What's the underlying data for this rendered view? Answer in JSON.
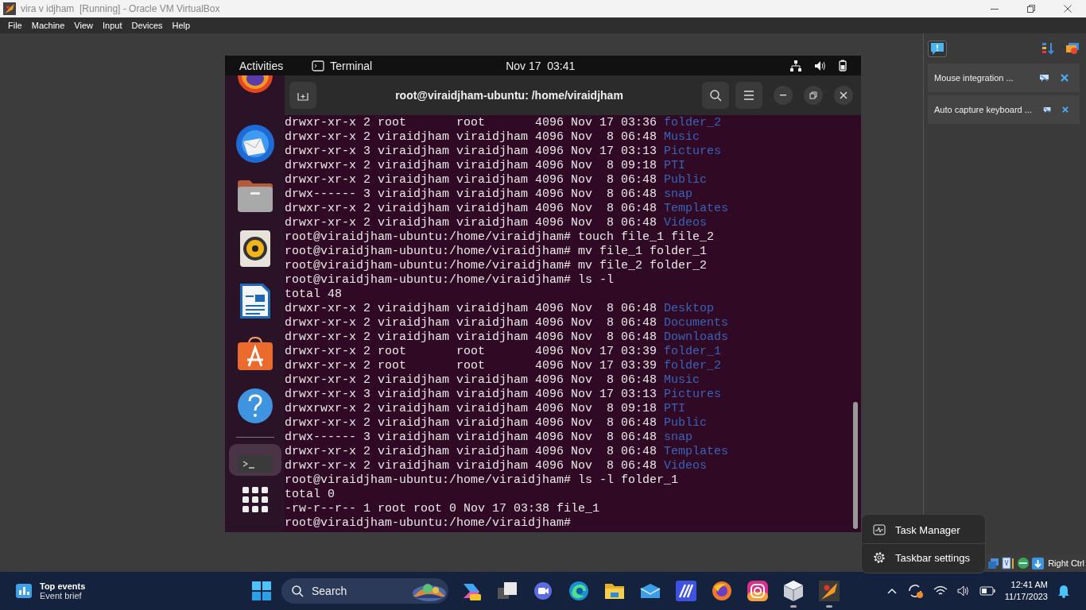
{
  "window": {
    "title": "vira v idjham  [Running] - Oracle VM VirtualBox"
  },
  "menu": [
    "File",
    "Machine",
    "View",
    "Input",
    "Devices",
    "Help"
  ],
  "guest": {
    "top_bar": {
      "activities": "Activities",
      "app": "Terminal",
      "clock": "Nov 17  03:41"
    },
    "dock": [
      {
        "kind": "firefox",
        "selected": false
      },
      {
        "kind": "thunderbird",
        "selected": false
      },
      {
        "kind": "files",
        "selected": false
      },
      {
        "kind": "rhythmbox",
        "selected": false
      },
      {
        "kind": "writer",
        "selected": false
      },
      {
        "kind": "appcenter",
        "selected": false
      },
      {
        "kind": "help",
        "selected": false
      },
      {
        "kind": "terminal",
        "selected": true
      },
      {
        "kind": "apps",
        "selected": false
      }
    ],
    "terminal": {
      "title": "root@viraidjham-ubuntu: /home/viraidjham",
      "lines": [
        {
          "text": "drwxr-xr-x 2 root       root       4096 Nov 17 03:36 ",
          "dir": "folder_2"
        },
        {
          "text": "drwxr-xr-x 2 viraidjham viraidjham 4096 Nov  8 06:48 ",
          "dir": "Music"
        },
        {
          "text": "drwxr-xr-x 3 viraidjham viraidjham 4096 Nov 17 03:13 ",
          "dir": "Pictures"
        },
        {
          "text": "drwxrwxr-x 2 viraidjham viraidjham 4096 Nov  8 09:18 ",
          "dir": "PTI"
        },
        {
          "text": "drwxr-xr-x 2 viraidjham viraidjham 4096 Nov  8 06:48 ",
          "dir": "Public"
        },
        {
          "text": "drwx------ 3 viraidjham viraidjham 4096 Nov  8 06:48 ",
          "dir": "snap"
        },
        {
          "text": "drwxr-xr-x 2 viraidjham viraidjham 4096 Nov  8 06:48 ",
          "dir": "Templates"
        },
        {
          "text": "drwxr-xr-x 2 viraidjham viraidjham 4096 Nov  8 06:48 ",
          "dir": "Videos"
        },
        {
          "text": "root@viraidjham-ubuntu:/home/viraidjham# touch file_1 file_2"
        },
        {
          "text": "root@viraidjham-ubuntu:/home/viraidjham# mv file_1 folder_1"
        },
        {
          "text": "root@viraidjham-ubuntu:/home/viraidjham# mv file_2 folder_2"
        },
        {
          "text": "root@viraidjham-ubuntu:/home/viraidjham# ls -l"
        },
        {
          "text": "total 48"
        },
        {
          "text": "drwxr-xr-x 2 viraidjham viraidjham 4096 Nov  8 06:48 ",
          "dir": "Desktop"
        },
        {
          "text": "drwxr-xr-x 2 viraidjham viraidjham 4096 Nov  8 06:48 ",
          "dir": "Documents"
        },
        {
          "text": "drwxr-xr-x 2 viraidjham viraidjham 4096 Nov  8 06:48 ",
          "dir": "Downloads"
        },
        {
          "text": "drwxr-xr-x 2 root       root       4096 Nov 17 03:39 ",
          "dir": "folder_1"
        },
        {
          "text": "drwxr-xr-x 2 root       root       4096 Nov 17 03:39 ",
          "dir": "folder_2"
        },
        {
          "text": "drwxr-xr-x 2 viraidjham viraidjham 4096 Nov  8 06:48 ",
          "dir": "Music"
        },
        {
          "text": "drwxr-xr-x 3 viraidjham viraidjham 4096 Nov 17 03:13 ",
          "dir": "Pictures"
        },
        {
          "text": "drwxrwxr-x 2 viraidjham viraidjham 4096 Nov  8 09:18 ",
          "dir": "PTI"
        },
        {
          "text": "drwxr-xr-x 2 viraidjham viraidjham 4096 Nov  8 06:48 ",
          "dir": "Public"
        },
        {
          "text": "drwx------ 3 viraidjham viraidjham 4096 Nov  8 06:48 ",
          "dir": "snap"
        },
        {
          "text": "drwxr-xr-x 2 viraidjham viraidjham 4096 Nov  8 06:48 ",
          "dir": "Templates"
        },
        {
          "text": "drwxr-xr-x 2 viraidjham viraidjham 4096 Nov  8 06:48 ",
          "dir": "Videos"
        },
        {
          "text": "root@viraidjham-ubuntu:/home/viraidjham# ls -l folder_1"
        },
        {
          "text": "total 0"
        },
        {
          "text": "-rw-r--r-- 1 root root 0 Nov 17 03:38 file_1"
        },
        {
          "text": "root@viraidjham-ubuntu:/home/viraidjham#"
        }
      ]
    }
  },
  "notifications": [
    {
      "text": "Mouse integration ..."
    },
    {
      "text": "Auto capture keyboard ..."
    }
  ],
  "status_bar": {
    "host_key": "Right Ctrl"
  },
  "context_menu": [
    {
      "kind": "task-manager",
      "label": "Task Manager"
    },
    {
      "kind": "settings",
      "label": "Taskbar settings"
    }
  ],
  "taskbar": {
    "widget": {
      "title": "Top events",
      "subtitle": "Event brief"
    },
    "search": {
      "placeholder": "Search"
    },
    "apps": [
      {
        "kind": "copilot",
        "running": false
      },
      {
        "kind": "task-view",
        "running": false
      },
      {
        "kind": "video",
        "running": false
      },
      {
        "kind": "edge",
        "running": false
      },
      {
        "kind": "folder",
        "running": false
      },
      {
        "kind": "mail",
        "running": false
      },
      {
        "kind": "stripes",
        "running": false
      },
      {
        "kind": "firefox",
        "running": false
      },
      {
        "kind": "instagram",
        "running": false
      },
      {
        "kind": "cube",
        "running": true
      },
      {
        "kind": "vbox",
        "running": true
      }
    ],
    "clock": {
      "time": "12:41 AM",
      "date": "11/17/2023"
    }
  }
}
